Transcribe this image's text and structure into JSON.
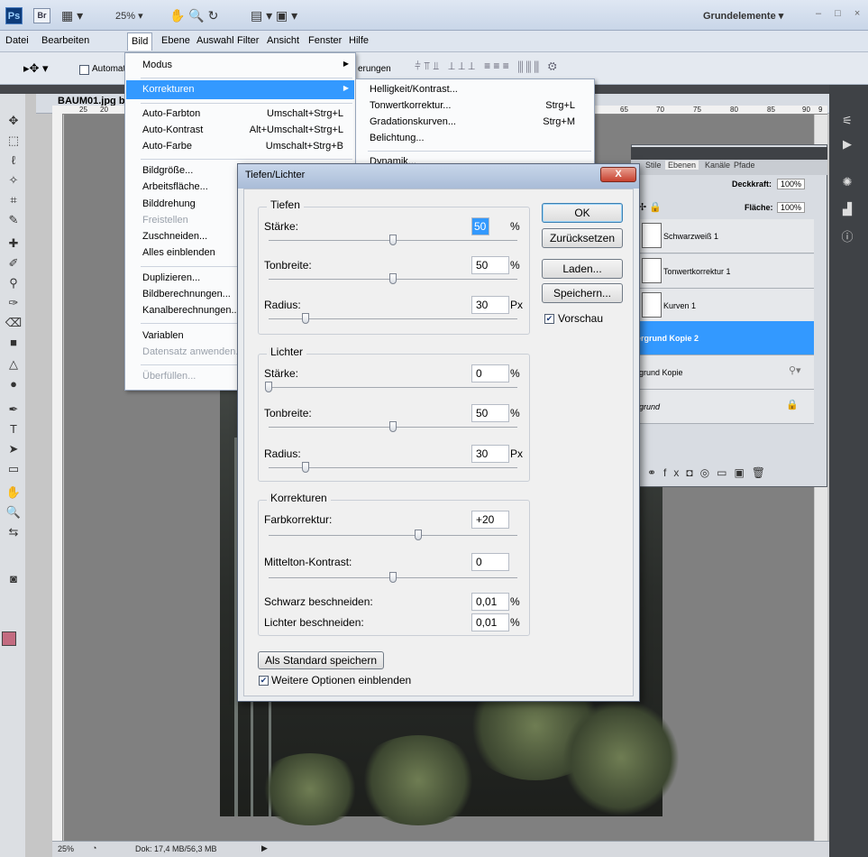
{
  "appbar": {
    "logo": "Ps",
    "bridge": "Br",
    "zoom": "25%",
    "workspace": "Grundelemente",
    "window_controls": "– □ ×"
  },
  "menubar": {
    "items": [
      "Datei",
      "Bearbeiten",
      "Bild",
      "Ebene",
      "Auswahl",
      "Filter",
      "Ansicht",
      "Fenster",
      "Hilfe"
    ]
  },
  "optbar": {
    "auto_label": "Automati",
    "adjust_fragment": "erungen"
  },
  "document": {
    "title": "BAUM01.jpg b"
  },
  "bild_menu": {
    "items": [
      {
        "label": "Modus",
        "shortcut": "",
        "submenu": true,
        "disabled": false
      },
      {
        "label": "Korrekturen",
        "shortcut": "",
        "submenu": true,
        "highlighted": true,
        "disabled": false
      },
      {
        "label": "Auto-Farbton",
        "shortcut": "Umschalt+Strg+L",
        "disabled": false
      },
      {
        "label": "Auto-Kontrast",
        "shortcut": "Alt+Umschalt+Strg+L",
        "disabled": false
      },
      {
        "label": "Auto-Farbe",
        "shortcut": "Umschalt+Strg+B",
        "disabled": false
      },
      {
        "label": "Bildgröße...",
        "shortcut": "",
        "disabled": false
      },
      {
        "label": "Arbeitsfläche...",
        "shortcut": "",
        "disabled": false
      },
      {
        "label": "Bilddrehung",
        "shortcut": "",
        "disabled": false
      },
      {
        "label": "Freistellen",
        "shortcut": "",
        "disabled": true
      },
      {
        "label": "Zuschneiden...",
        "shortcut": "",
        "disabled": false
      },
      {
        "label": "Alles einblenden",
        "shortcut": "",
        "disabled": false
      },
      {
        "label": "Duplizieren...",
        "shortcut": "",
        "disabled": false
      },
      {
        "label": "Bildberechnungen...",
        "shortcut": "",
        "disabled": false
      },
      {
        "label": "Kanalberechnungen...",
        "shortcut": "",
        "disabled": false
      },
      {
        "label": "Variablen",
        "shortcut": "",
        "disabled": false
      },
      {
        "label": "Datensatz anwenden...",
        "shortcut": "",
        "disabled": true
      },
      {
        "label": "Überfüllen...",
        "shortcut": "",
        "disabled": true
      }
    ]
  },
  "korrekturen_submenu": {
    "items": [
      {
        "label": "Helligkeit/Kontrast...",
        "shortcut": ""
      },
      {
        "label": "Tonwertkorrektur...",
        "shortcut": "Strg+L"
      },
      {
        "label": "Gradationskurven...",
        "shortcut": "Strg+M"
      },
      {
        "label": "Belichtung...",
        "shortcut": ""
      },
      {
        "label": "Dynamik...",
        "shortcut": ""
      }
    ]
  },
  "layers_panel": {
    "tabs": [
      "Stile",
      "Ebenen",
      "Kanäle",
      "Pfade"
    ],
    "opacity_label": "Deckkraft:",
    "opacity_value": "100%",
    "fill_label": "Fläche:",
    "fill_value": "100%",
    "layers": [
      {
        "name": "Schwarzweiß 1",
        "selected": false
      },
      {
        "name": "Tonwertkorrektur 1",
        "selected": false
      },
      {
        "name": "Kurven 1",
        "selected": false
      },
      {
        "name": "ergrund Kopie 2",
        "selected": true
      },
      {
        "name": "rgrund Kopie",
        "selected": false
      },
      {
        "name": "rgrund",
        "selected": false
      }
    ]
  },
  "dialog": {
    "title": "Tiefen/Lichter",
    "close": "X",
    "groups": {
      "tiefen": {
        "label": "Tiefen",
        "rows": [
          {
            "label": "Stärke:",
            "value": "50",
            "unit": "%",
            "slider": 0.5
          },
          {
            "label": "Tonbreite:",
            "value": "50",
            "unit": "%",
            "slider": 0.5
          },
          {
            "label": "Radius:",
            "value": "30",
            "unit": "Px",
            "slider": 0.15
          }
        ]
      },
      "lichter": {
        "label": "Lichter",
        "rows": [
          {
            "label": "Stärke:",
            "value": "0",
            "unit": "%",
            "slider": 0.0
          },
          {
            "label": "Tonbreite:",
            "value": "50",
            "unit": "%",
            "slider": 0.5
          },
          {
            "label": "Radius:",
            "value": "30",
            "unit": "Px",
            "slider": 0.15
          }
        ]
      },
      "korrekturen": {
        "label": "Korrekturen",
        "rows": [
          {
            "label": "Farbkorrektur:",
            "value": "+20",
            "unit": "",
            "slider": 0.6
          },
          {
            "label": "Mittelton-Kontrast:",
            "value": "0",
            "unit": "",
            "slider": 0.5
          },
          {
            "label": "Schwarz beschneiden:",
            "value": "0,01",
            "unit": "%"
          },
          {
            "label": "Lichter beschneiden:",
            "value": "0,01",
            "unit": "%"
          }
        ]
      }
    },
    "buttons": {
      "ok": "OK",
      "reset": "Zurücksetzen",
      "load": "Laden...",
      "save": "Speichern..."
    },
    "preview_label": "Vorschau",
    "preview_checked": true,
    "save_default": "Als Standard speichern",
    "more_options": "Weitere Optionen einblenden",
    "more_options_checked": true
  },
  "statusbar": {
    "zoom": "25%",
    "doc_info": "Dok: 17,4 MB/56,3 MB"
  },
  "rulers": {
    "horizontal": [
      "25",
      "20",
      "65",
      "70",
      "75",
      "80",
      "85",
      "90",
      "9"
    ]
  },
  "colors": {
    "accent": "#3399ff",
    "foreground_swatch": "#c36b80"
  }
}
